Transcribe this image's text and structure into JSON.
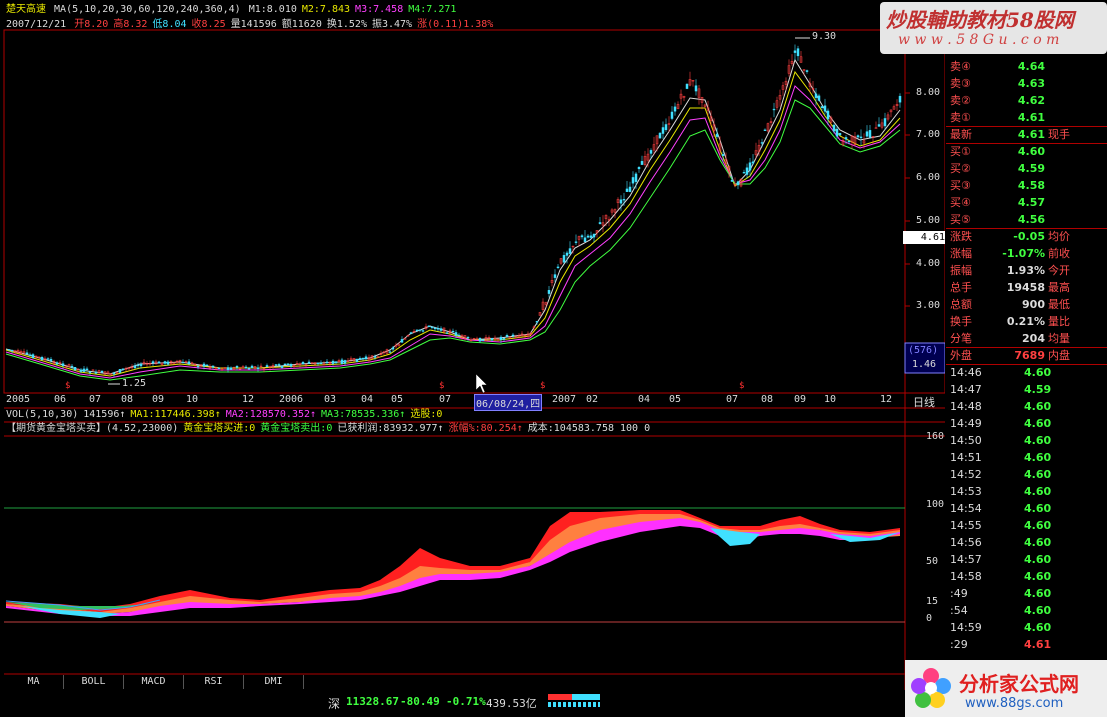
{
  "header": {
    "stock_name": "楚天高速",
    "ma_params": "MA(5,10,20,30,60,120,240,360,4)",
    "ma_values": [
      {
        "label": "M1:8.010",
        "color": "#dcdcdc"
      },
      {
        "label": "M2:7.843",
        "color": "#e8e800"
      },
      {
        "label": "M3:7.458",
        "color": "#ff40ff"
      },
      {
        "label": "M4:7.271",
        "color": "#40ff40"
      }
    ],
    "date": "2007/12/21",
    "ohlc": [
      {
        "label": "开8.20",
        "color": "#ff4040"
      },
      {
        "label": "高8.32",
        "color": "#ff4040"
      },
      {
        "label": "低8.04",
        "color": "#40e0ff"
      },
      {
        "label": "收8.25",
        "color": "#ff4040"
      },
      {
        "label": "量141596",
        "color": "#dcdcdc"
      },
      {
        "label": "额11620",
        "color": "#dcdcdc"
      },
      {
        "label": "换1.52%",
        "color": "#dcdcdc"
      },
      {
        "label": "振3.47%",
        "color": "#dcdcdc"
      },
      {
        "label": "涨(0.11)1.38%",
        "color": "#ff4040"
      }
    ]
  },
  "main_chart": {
    "price_axis_labels": [
      "8.00",
      "7.00",
      "6.00",
      "5.00",
      "4.00",
      "3.00"
    ],
    "current_price_tag": "4.61",
    "high_label": "9.30",
    "low_label": "1.25",
    "box_labels": [
      "(576)",
      "1.46"
    ]
  },
  "time_axis": {
    "labels": [
      "2005",
      "06",
      "07",
      "08",
      "09",
      "10",
      "12",
      "2006",
      "03",
      "04",
      "05",
      "07",
      "06/08/24,四",
      "2007",
      "02",
      "04",
      "05",
      "07",
      "08",
      "09",
      "10",
      "12"
    ],
    "period": "日线"
  },
  "vol_header": [
    {
      "label": "VOL(5,10,30)",
      "color": "#dcdcdc"
    },
    {
      "label": "141596↑",
      "color": "#dcdcdc"
    },
    {
      "label": "MA1:117446.398↑",
      "color": "#e8e800"
    },
    {
      "label": "MA2:128570.352↑",
      "color": "#ff40ff"
    },
    {
      "label": "MA3:78535.336↑",
      "color": "#40ff40"
    },
    {
      "label": "选股:0",
      "color": "#e8e800"
    }
  ],
  "indicator_header": [
    {
      "label": "【期货黄金宝塔买卖】(4.52,23000)",
      "color": "#dcdcdc"
    },
    {
      "label": "黄金宝塔买进:0",
      "color": "#e8e800"
    },
    {
      "label": "黄金宝塔卖出:0",
      "color": "#40ff40"
    },
    {
      "label": "已获利润:83932.977↑",
      "color": "#dcdcdc"
    },
    {
      "label": "涨幅%:80.254↑",
      "color": "#ff4040"
    },
    {
      "label": "成本:104583.758 100 0",
      "color": "#dcdcdc"
    }
  ],
  "indicator_axis_labels": [
    "160",
    "100",
    "50",
    "15",
    "0"
  ],
  "tabs": [
    "MA",
    "BOLL",
    "MACD",
    "RSI",
    "DMI"
  ],
  "order_book": {
    "asks": [
      {
        "label": "卖④",
        "value": "4.64"
      },
      {
        "label": "卖③",
        "value": "4.63"
      },
      {
        "label": "卖②",
        "value": "4.62"
      },
      {
        "label": "卖①",
        "value": "4.61"
      }
    ],
    "latest": {
      "label": "最新",
      "value": "4.61",
      "right": "现手"
    },
    "bids": [
      {
        "label": "买①",
        "value": "4.60"
      },
      {
        "label": "买②",
        "value": "4.59"
      },
      {
        "label": "买③",
        "value": "4.58"
      },
      {
        "label": "买④",
        "value": "4.57"
      },
      {
        "label": "买⑤",
        "value": "4.56"
      }
    ],
    "stats": [
      {
        "label": "涨跌",
        "value": "-0.05",
        "right": "均价",
        "color": "#40ff40"
      },
      {
        "label": "涨幅",
        "value": "-1.07%",
        "right": "前收",
        "color": "#40ff40"
      },
      {
        "label": "振幅",
        "value": "1.93%",
        "right": "今开",
        "color": "#dcdcdc"
      },
      {
        "label": "总手",
        "value": "19458",
        "right": "最高",
        "color": "#dcdcdc"
      },
      {
        "label": "总额",
        "value": "900",
        "right": "最低",
        "color": "#dcdcdc"
      },
      {
        "label": "换手",
        "value": "0.21%",
        "right": "量比",
        "color": "#dcdcdc"
      },
      {
        "label": "分笔",
        "value": "204",
        "right": "均量",
        "color": "#dcdcdc"
      }
    ],
    "outer": {
      "label": "外盘",
      "value": "7689",
      "right": "内盘"
    }
  },
  "ticks": [
    {
      "time": "14:46",
      "price": "4.60"
    },
    {
      "time": "14:47",
      "price": "4.59"
    },
    {
      "time": "14:48",
      "price": "4.60"
    },
    {
      "time": "14:49",
      "price": "4.60"
    },
    {
      "time": "14:50",
      "price": "4.60"
    },
    {
      "time": "14:51",
      "price": "4.60"
    },
    {
      "time": "14:52",
      "price": "4.60"
    },
    {
      "time": "14:53",
      "price": "4.60"
    },
    {
      "time": "14:54",
      "price": "4.60"
    },
    {
      "time": "14:55",
      "price": "4.60"
    },
    {
      "time": "14:56",
      "price": "4.60"
    },
    {
      "time": "14:57",
      "price": "4.60"
    },
    {
      "time": "14:58",
      "price": "4.60"
    },
    {
      "time": ":49",
      "price": "4.60"
    },
    {
      "time": ":54",
      "price": "4.60"
    },
    {
      "time": "14:59",
      "price": "4.60"
    },
    {
      "time": ":29",
      "price": "4.61"
    }
  ],
  "status_bar": {
    "index_name": "深",
    "index_value": "11328.67",
    "change": "-80.49",
    "pct": "-0.71%",
    "amount": "439.53亿"
  },
  "watermark_top": {
    "text": "炒股輔助教材58股网",
    "url": "w w w . 5 8 G u . c o m"
  },
  "watermark_bottom": {
    "text": "分析家公式网",
    "url": "www.88gs.com"
  },
  "colors": {
    "up": "#ff4040",
    "down": "#40e0ff",
    "border": "#c00000"
  }
}
